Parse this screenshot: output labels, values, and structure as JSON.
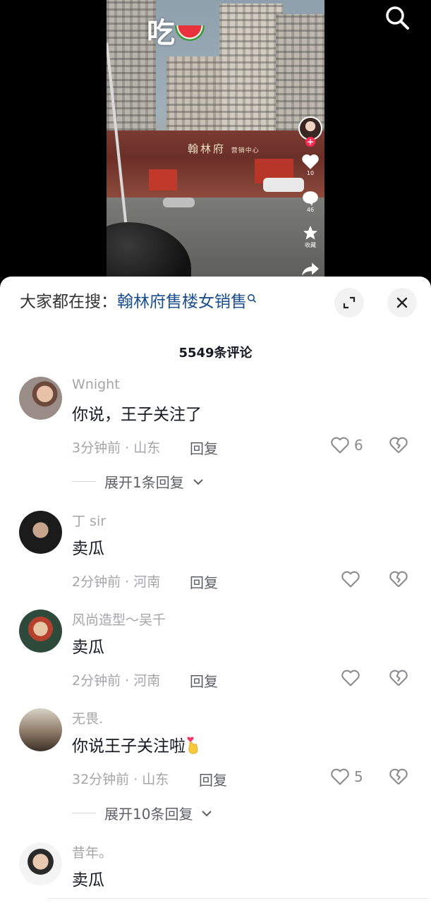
{
  "video": {
    "overlay_text": "吃",
    "overlay_emoji": "watermelon",
    "store_sign_main": "翰林府",
    "store_sign_sub": "营销中心",
    "rail": {
      "like_count": "10",
      "comment_count": "46",
      "favorite_label": "收藏"
    }
  },
  "top": {
    "search_icon": "search-icon"
  },
  "sheet": {
    "search_prefix": "大家都在搜：",
    "search_keyword": "翰林府售楼女销售",
    "comment_count_label": "5549条评论",
    "comments": [
      {
        "username": "Wnight",
        "text": "你说，王子关注了",
        "meta": "3分钟前 · 山东",
        "reply_label": "回复",
        "likes": "6",
        "expand_label": "展开1条回复"
      },
      {
        "username": "丁 sir",
        "text": "卖瓜",
        "meta": "2分钟前 · 河南",
        "reply_label": "回复",
        "likes": ""
      },
      {
        "username": "风尚造型～吴千",
        "text": "卖瓜",
        "meta": "2分钟前 · 河南",
        "reply_label": "回复",
        "likes": ""
      },
      {
        "username": "无畏.",
        "text": "你说王子关注啦",
        "emoji": "crossed-fingers-heart",
        "meta": "32分钟前 · 山东",
        "reply_label": "回复",
        "likes": "5",
        "expand_label": "展开10条回复"
      },
      {
        "username": "昔年。",
        "text": "卖瓜"
      }
    ]
  },
  "colors": {
    "keyword": "#1a4e8c",
    "muted": "#a5a5a9",
    "text": "#161823",
    "accent": "#fe2c55"
  }
}
